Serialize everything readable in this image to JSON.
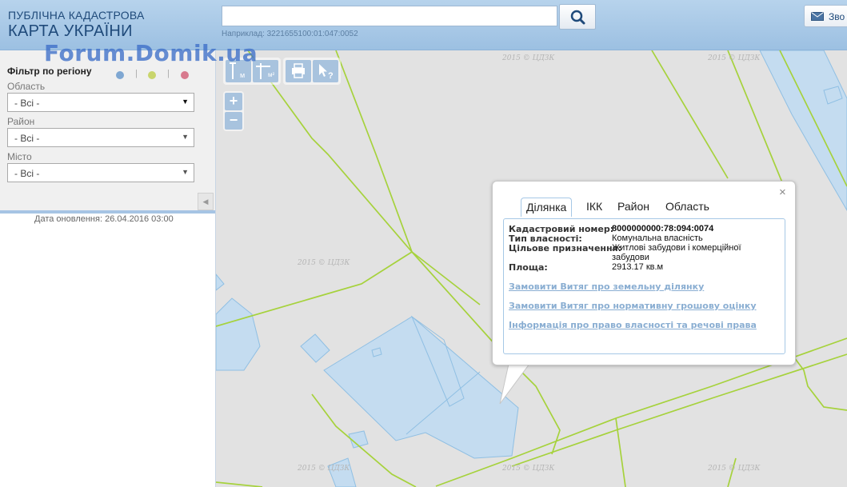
{
  "header": {
    "logo_line1": "ПУБЛІЧНА КАДАСТРОВА",
    "logo_line2": "КАРТА УКРАЇНИ",
    "search": {
      "placeholder": "",
      "value": "",
      "hint": "Наприклад: 3221655100:01:047:0052"
    },
    "feedback_label": "Зво"
  },
  "watermark": "Forum.Domik.ua",
  "sidebar": {
    "filter_title": "Фільтр по регіону",
    "dot_colors": [
      "#7fa7d2",
      "#c9d56c",
      "#d87a8e"
    ],
    "fields": [
      {
        "label": "Область",
        "value": "- Всі -"
      },
      {
        "label": "Район",
        "value": "- Всі -"
      },
      {
        "label": "Місто",
        "value": "- Всі -"
      }
    ],
    "update_date": "Дата оновлення: 26.04.2016 03:00"
  },
  "toolbar": {
    "tools": [
      {
        "name": "measure-distance",
        "icon": "ruler-icon",
        "unit": "м"
      },
      {
        "name": "measure-area",
        "icon": "area-icon",
        "unit": "м²"
      },
      {
        "name": "print",
        "icon": "print-icon"
      },
      {
        "name": "identify",
        "icon": "cursor-question-icon"
      }
    ],
    "zoom_in": "+",
    "zoom_out": "−"
  },
  "map": {
    "tile_watermark": "2015 © ЦДЗК",
    "colors": {
      "background": "#e2e2e2",
      "boundary": "#a6d23c",
      "parcel_fill": "#c4dcf0",
      "parcel_stroke": "#8fbfe3"
    }
  },
  "popup": {
    "tabs": [
      "Ділянка",
      "ІКК",
      "Район",
      "Область"
    ],
    "active_tab": "Ділянка",
    "close": "×",
    "fields": [
      {
        "label": "Кадастровий номер:",
        "value": "8000000000:78:094:0074"
      },
      {
        "label": "Тип власності:",
        "value": "Комунальна власність"
      },
      {
        "label": "Цільове призначення:",
        "value": "Житлові забудови і комерційної забудови"
      },
      {
        "label": "Площа:",
        "value": "2913.17 кв.м"
      }
    ],
    "links": [
      "Замовити Витяг про земельну ділянку",
      "Замовити Витяг про нормативну грошову оцінку",
      "Інформація про право власності та речові права"
    ]
  }
}
